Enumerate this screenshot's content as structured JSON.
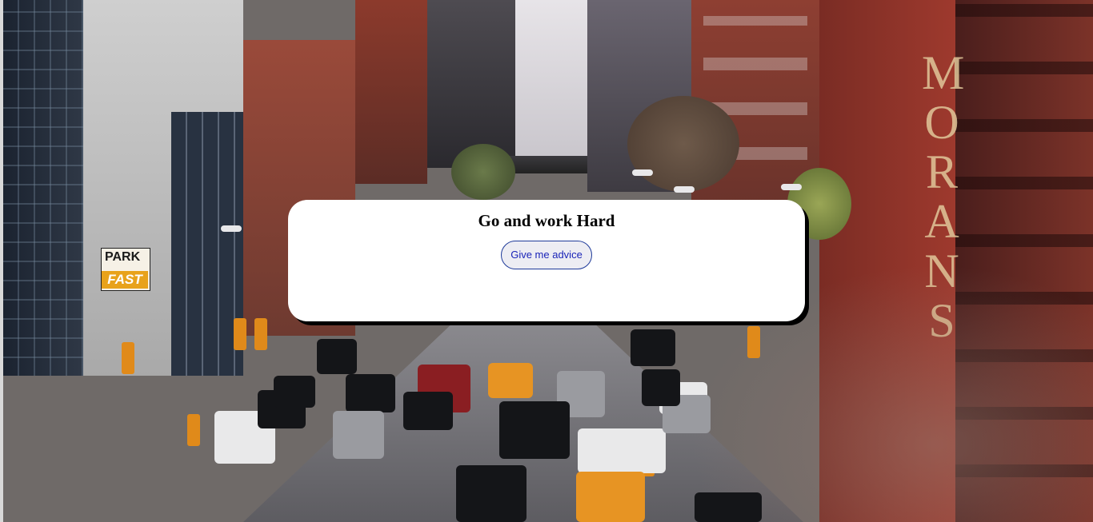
{
  "background": {
    "image_icon": "city-street-photo",
    "sign_letters": "MORANS",
    "parking_sign": [
      "PARK",
      "FAST"
    ]
  },
  "card": {
    "title": "Go and work Hard",
    "button_label": "Give me advice"
  },
  "colors": {
    "card_background": "#ffffff",
    "card_shadow": "#000000",
    "button_border": "#1f3b9a",
    "button_text": "#1a24b8",
    "button_background": "#ededf3"
  }
}
